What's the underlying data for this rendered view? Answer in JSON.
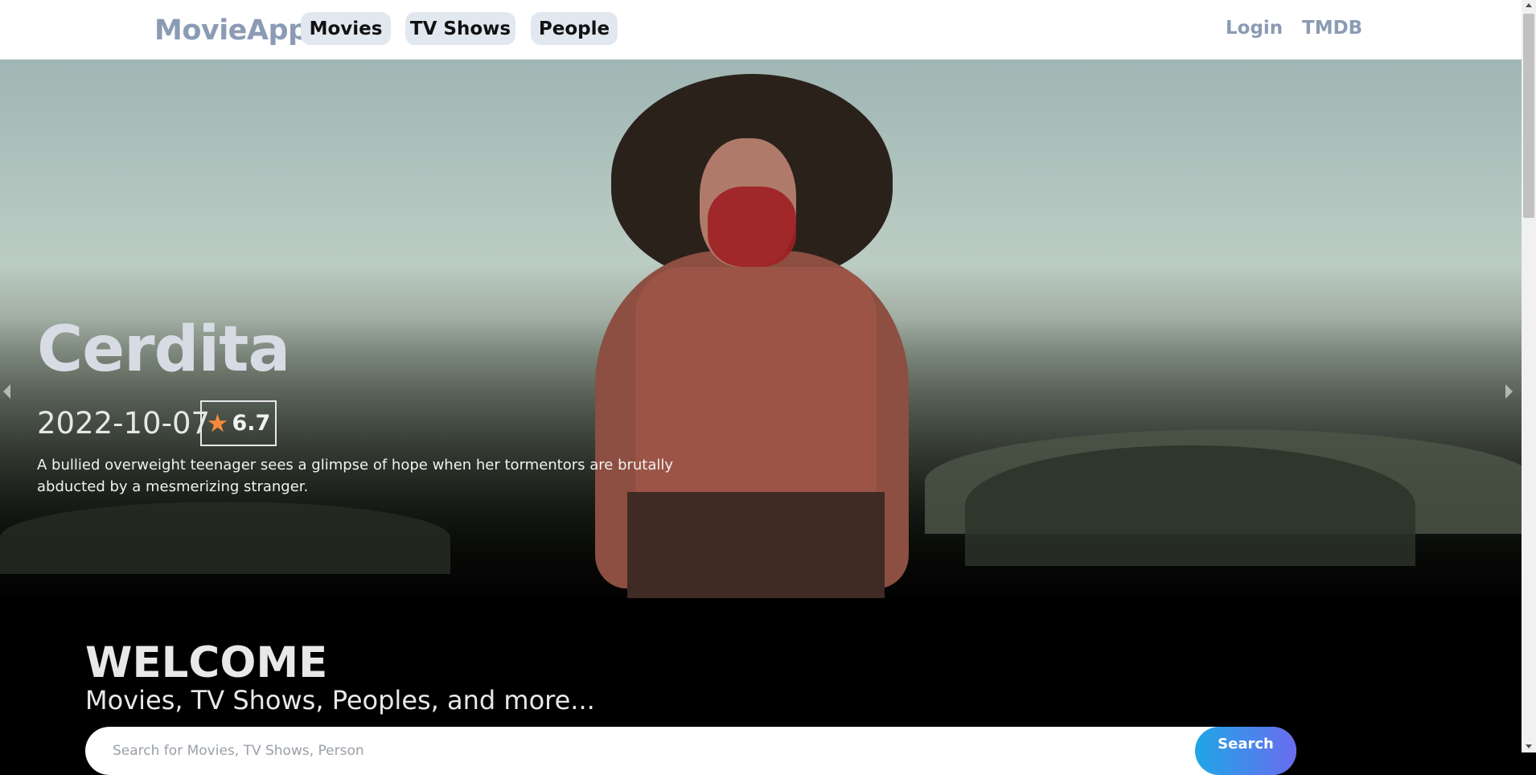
{
  "navbar": {
    "brand": "MovieApp",
    "items": [
      {
        "label": "Movies"
      },
      {
        "label": "TV Shows"
      },
      {
        "label": "People"
      }
    ],
    "right": {
      "login": "Login",
      "tmdb": "TMDB"
    }
  },
  "hero": {
    "title": "Cerdita",
    "date": "2022-10-07",
    "rating": "6.7",
    "rating_icon": "star-icon",
    "overview": "A bullied overweight teenager sees a glimpse of hope when her tormentors are brutally abducted by a mesmerizing stranger.",
    "carousel": {
      "total_slides": 20,
      "active_index": 3
    }
  },
  "welcome": {
    "title": "WELCOME",
    "subtitle": "Movies, TV Shows, Peoples, and more..."
  },
  "search": {
    "placeholder": "Search for Movies, TV Shows, Person",
    "value": "",
    "button_label": "Search"
  },
  "colors": {
    "brand": "#8b9bb4",
    "nav_pill": "#e2e8f0",
    "star": "#f6893b",
    "search_gradient_start": "#1fa6e6",
    "search_gradient_end": "#6a6cf0"
  }
}
